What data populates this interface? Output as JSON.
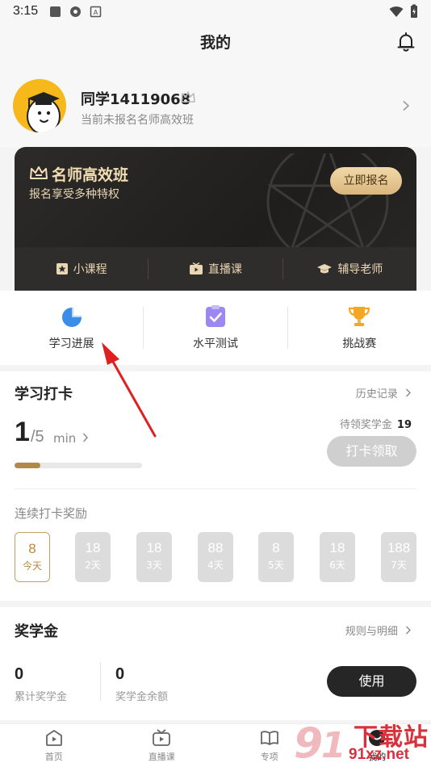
{
  "status_bar": {
    "time": "3:15"
  },
  "header": {
    "title": "我的"
  },
  "profile": {
    "name": "同学14119068",
    "subtitle": "当前未报名名师高效班"
  },
  "vip": {
    "title": "名师高效班",
    "subtitle": "报名享受多种特权",
    "button": "立即报名",
    "perks": [
      {
        "label": "小课程",
        "icon": "star-book-icon"
      },
      {
        "label": "直播课",
        "icon": "live-tv-icon"
      },
      {
        "label": "辅导老师",
        "icon": "graduation-cap-icon"
      }
    ]
  },
  "quick_actions": [
    {
      "label": "学习进展",
      "icon": "pie-chart-icon"
    },
    {
      "label": "水平测试",
      "icon": "clipboard-check-icon"
    },
    {
      "label": "挑战赛",
      "icon": "trophy-icon"
    }
  ],
  "checkin": {
    "title": "学习打卡",
    "history_link": "历史记录",
    "current": "1",
    "target": "/5",
    "unit": "min",
    "progress": 0.2,
    "pending_label": "待领奖学金",
    "pending_value": "19",
    "claim_button": "打卡领取",
    "streak_title": "连续打卡奖励",
    "days": [
      {
        "value": "8",
        "label": "今天",
        "active": true
      },
      {
        "value": "18",
        "label": "2天"
      },
      {
        "value": "18",
        "label": "3天"
      },
      {
        "value": "88",
        "label": "4天"
      },
      {
        "value": "8",
        "label": "5天"
      },
      {
        "value": "18",
        "label": "6天"
      },
      {
        "value": "188",
        "label": "7天"
      }
    ]
  },
  "scholarship": {
    "title": "奖学金",
    "rules_link": "规则与明细",
    "total_value": "0",
    "total_label": "累计奖学金",
    "balance_value": "0",
    "balance_label": "奖学金余额",
    "use_button": "使用"
  },
  "tabs": [
    {
      "label": "首页",
      "icon": "play-home-icon"
    },
    {
      "label": "直播课",
      "icon": "tv-icon"
    },
    {
      "label": "专项",
      "icon": "book-icon"
    },
    {
      "label": "我的",
      "icon": "profile-face-icon"
    }
  ],
  "watermark": {
    "text": "下载站",
    "url": "91xz.net"
  },
  "colors": {
    "accent_gold": "#c9a063",
    "watermark_red": "#d9313c",
    "annotation_arrow": "#e02020"
  }
}
